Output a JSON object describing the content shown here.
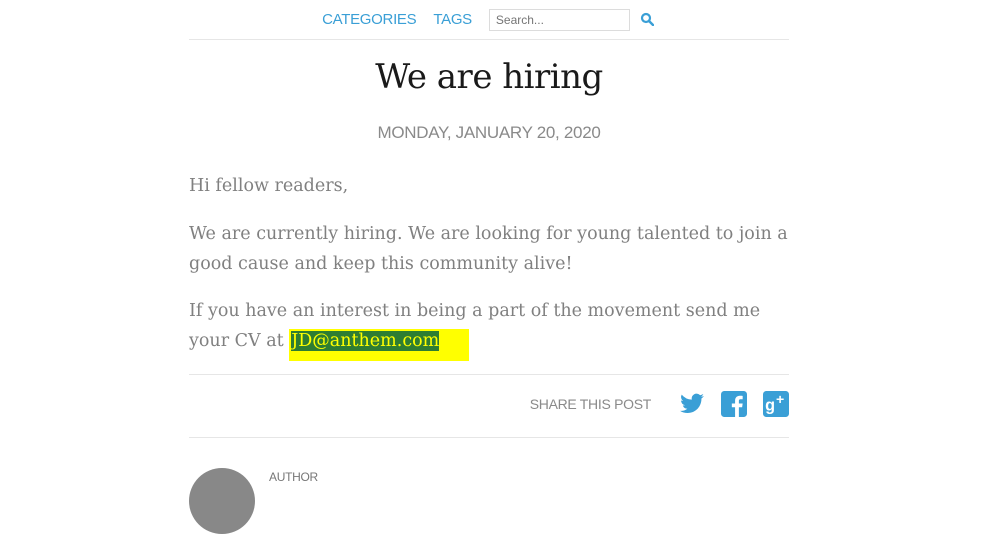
{
  "nav": {
    "categories_label": "CATEGORIES",
    "tags_label": "TAGS",
    "search_placeholder": "Search..."
  },
  "post": {
    "title": "We are hiring",
    "date": "MONDAY, JANUARY 20, 2020",
    "greeting": "Hi fellow readers,",
    "paragraph1": "We are currently hiring. We are looking for young talented to join a good cause and keep this community alive!",
    "paragraph2_prefix": "If you have an interest in being a part of the movement send me your CV at ",
    "email": "JD@anthem.com"
  },
  "share": {
    "label": "SHARE THIS POST",
    "icons": [
      "twitter-icon",
      "facebook-icon",
      "google-plus-icon"
    ]
  },
  "author": {
    "label": "AUTHOR"
  },
  "colors": {
    "accent": "#3a9fd6",
    "highlight": "#ffff00"
  }
}
